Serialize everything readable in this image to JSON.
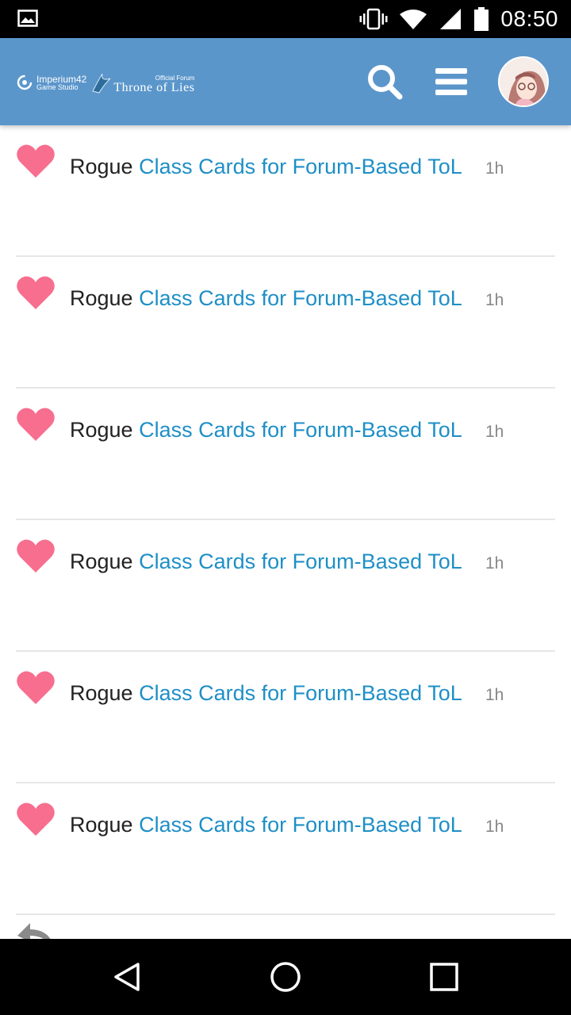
{
  "status_bar": {
    "time": "08:50",
    "icons": [
      "image-icon",
      "vibrate-icon",
      "wifi-icon",
      "signal-icon",
      "battery-icon"
    ]
  },
  "header": {
    "logo_imperium_line1": "Imperium42",
    "logo_imperium_line2": "Game Studio",
    "logo_forum_label": "Official Forum",
    "logo_forum_name": "Throne of Lies",
    "icons": [
      "search-icon",
      "menu-icon",
      "avatar"
    ],
    "background_color": "#5b96cb"
  },
  "notifications": [
    {
      "icon": "heart-icon",
      "user": "Rogue",
      "title": "Class Cards for Forum-Based ToL",
      "time": "1h"
    },
    {
      "icon": "heart-icon",
      "user": "Rogue",
      "title": "Class Cards for Forum-Based ToL",
      "time": "1h"
    },
    {
      "icon": "heart-icon",
      "user": "Rogue",
      "title": "Class Cards for Forum-Based ToL",
      "time": "1h"
    },
    {
      "icon": "heart-icon",
      "user": "Rogue",
      "title": "Class Cards for Forum-Based ToL",
      "time": "1h"
    },
    {
      "icon": "heart-icon",
      "user": "Rogue",
      "title": "Class Cards for Forum-Based ToL",
      "time": "1h"
    },
    {
      "icon": "heart-icon",
      "user": "Rogue",
      "title": "Class Cards for Forum-Based ToL",
      "time": "1h"
    }
  ],
  "colors": {
    "heart": "#f76e8e",
    "link": "#1e8fc6",
    "time": "#888888"
  },
  "nav_bar": {
    "buttons": [
      "back-icon",
      "home-icon",
      "recents-icon"
    ]
  }
}
